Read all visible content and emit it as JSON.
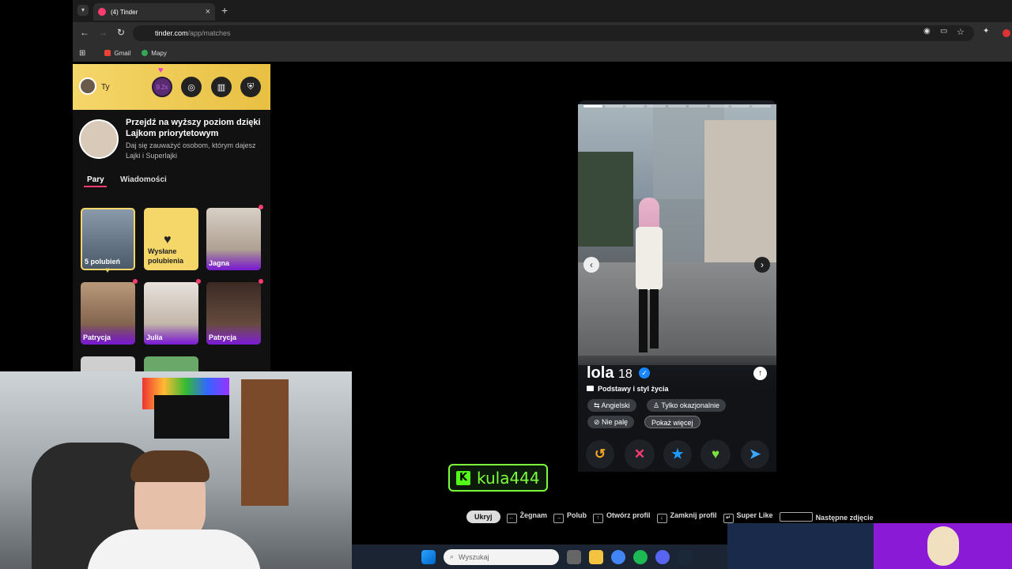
{
  "browser": {
    "tab_title": "(4) Tinder",
    "url_host": "tinder.com",
    "url_path": "/app/matches",
    "bookmarks": [
      "Gmail",
      "Mapy"
    ]
  },
  "sidebar": {
    "me_label": "Ty",
    "boost_label": "9.2x",
    "promo_title": "Przejdź na wyższy poziom dzięki Lajkom priorytetowym",
    "promo_subtitle": "Daj się zauważyć osobom, którym dajesz Lajki i Superlajki",
    "tabs": [
      "Pary",
      "Wiadomości"
    ],
    "matches": [
      {
        "label": "5 polubień"
      },
      {
        "label": "Wysłane polubienia"
      },
      {
        "label": "Jagna"
      },
      {
        "label": "Patrycja"
      },
      {
        "label": "Julia"
      },
      {
        "label": "Patrycja"
      }
    ]
  },
  "card": {
    "name": "lola",
    "age": "18",
    "basics": "Podstawy i styl życia",
    "chips": [
      "Angielski",
      "Tylko okazjonalnie",
      "Nie palę",
      "Pokaż więcej"
    ],
    "photo_count": 9,
    "photo_index": 1
  },
  "overlay": {
    "kick_name": "kula444",
    "hide_label": "Ukryj",
    "shortcuts": [
      "Żegnam",
      "Polub",
      "Otwórz profil",
      "Zamknij profil",
      "Super Like",
      "Następne zdjęcie"
    ]
  },
  "taskbar": {
    "search_placeholder": "Wyszukaj"
  },
  "colors": {
    "tinder_pink": "#fe3c72",
    "gold": "#f5d669",
    "kick_green": "#7cff3a"
  }
}
